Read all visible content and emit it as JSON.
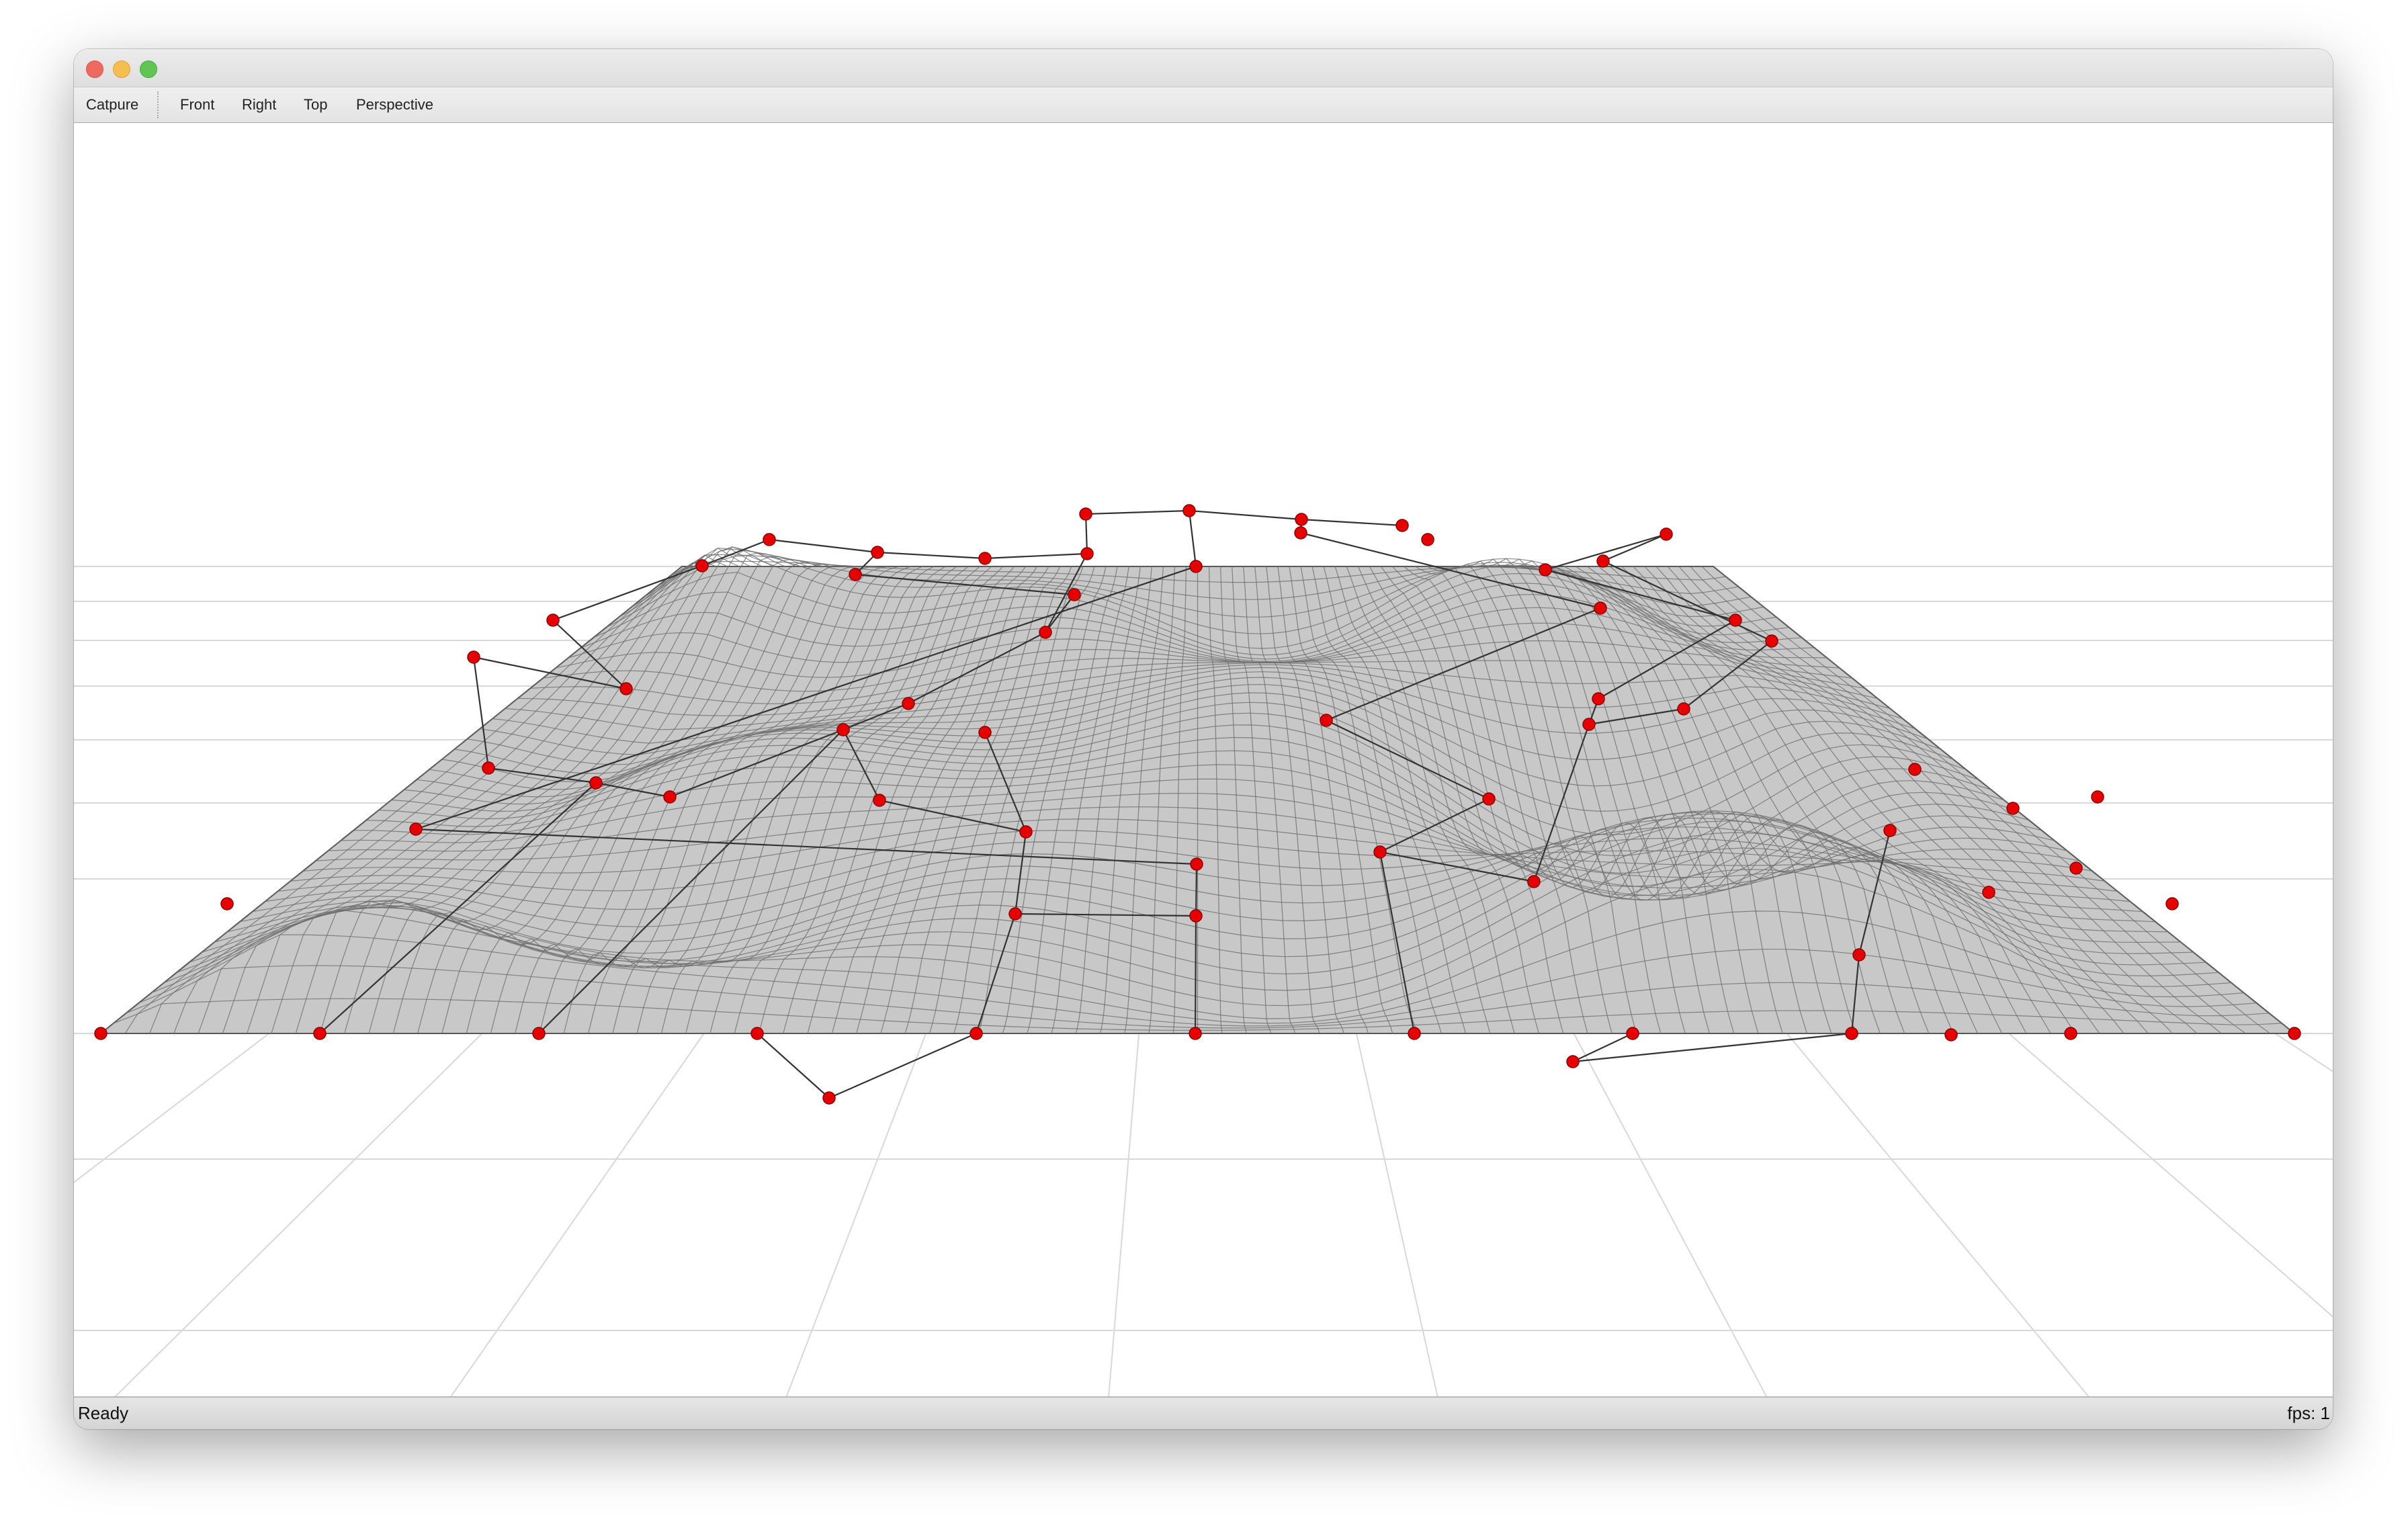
{
  "toolbar": {
    "capture_label": "Catpure",
    "front_label": "Front",
    "right_label": "Right",
    "top_label": "Top",
    "perspective_label": "Perspective"
  },
  "status": {
    "text": "Ready",
    "fps": "fps: 1"
  },
  "colors": {
    "surface_fill": "#c8c8c8",
    "surface_mesh": "#6e6e6e",
    "control_point": "#e60000",
    "control_line": "#333333",
    "floor_grid": "#d8d8d8"
  },
  "icons": {
    "close": "traffic-light-close-icon",
    "minimize": "traffic-light-minimize-icon",
    "maximize": "traffic-light-maximize-icon"
  }
}
